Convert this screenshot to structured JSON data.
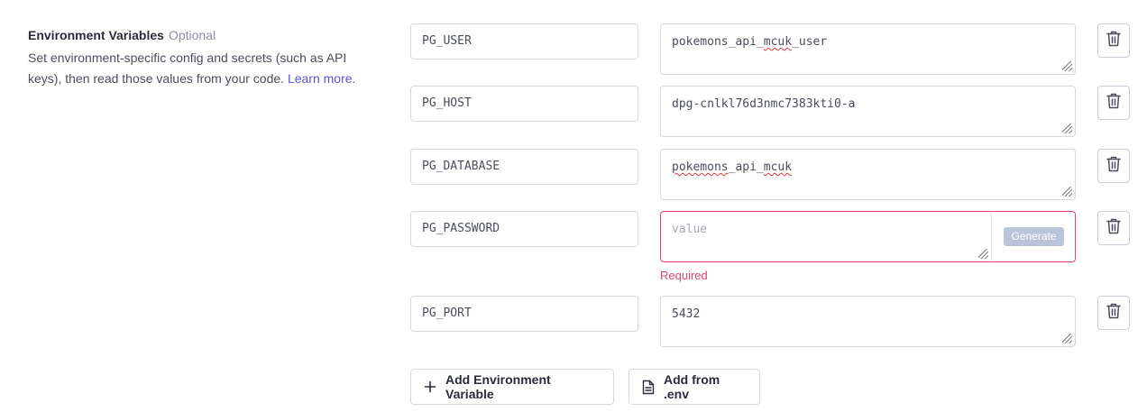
{
  "section": {
    "title": "Environment Variables",
    "optional": "Optional",
    "description": "Set environment-specific config and secrets (such as API keys), then read those values from your code.",
    "learn_more": "Learn more."
  },
  "env_vars": [
    {
      "key": "PG_USER",
      "value": "pokemons_api_mcuk_user"
    },
    {
      "key": "PG_HOST",
      "value": "dpg-cnlkl76d3nmc7383kti0-a"
    },
    {
      "key": "PG_DATABASE",
      "value": "pokemons_api_mcuk"
    },
    {
      "key": "PG_PASSWORD",
      "value": "",
      "placeholder": "value",
      "generate_label": "Generate",
      "error": "Required"
    },
    {
      "key": "PG_PORT",
      "value": "5432"
    }
  ],
  "actions": {
    "add_variable": "Add Environment Variable",
    "add_from_env": "Add from .env"
  },
  "colors": {
    "error": "#e2456b",
    "link": "#5a53d6",
    "generate_bg": "#b9c3d9"
  },
  "icons": {
    "delete": "trash-icon",
    "add": "plus-icon",
    "file": "file-icon"
  }
}
